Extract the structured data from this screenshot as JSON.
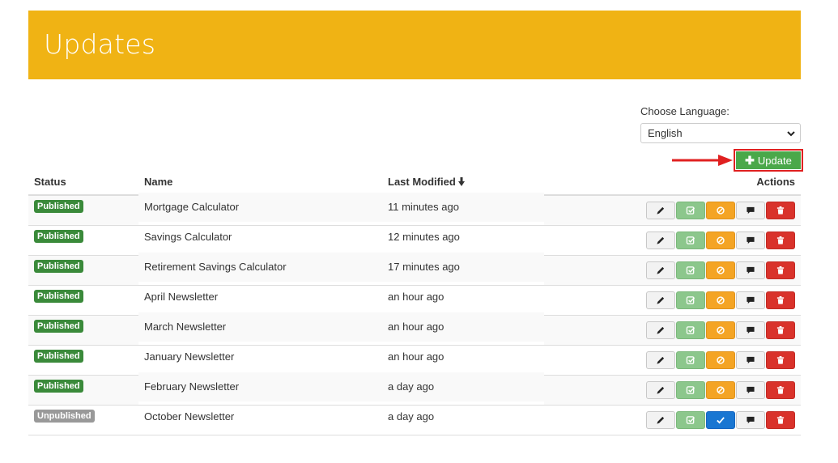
{
  "header": {
    "title": "Updates",
    "color": "#f0b314"
  },
  "language": {
    "label": "Choose Language:",
    "selected": "English"
  },
  "toolbar": {
    "update_label": "Update"
  },
  "table": {
    "columns": {
      "status": "Status",
      "name": "Name",
      "last_modified": "Last Modified",
      "actions": "Actions"
    },
    "rows": [
      {
        "status": "Published",
        "name": "Mortgage Calculator",
        "modified": "11 minutes ago"
      },
      {
        "status": "Published",
        "name": "Savings Calculator",
        "modified": "12 minutes ago"
      },
      {
        "status": "Published",
        "name": "Retirement Savings Calculator",
        "modified": "17 minutes ago"
      },
      {
        "status": "Published",
        "name": "April Newsletter",
        "modified": "an hour ago"
      },
      {
        "status": "Published",
        "name": "March Newsletter",
        "modified": "an hour ago"
      },
      {
        "status": "Published",
        "name": "January Newsletter",
        "modified": "an hour ago"
      },
      {
        "status": "Published",
        "name": "February Newsletter",
        "modified": "a day ago"
      },
      {
        "status": "Unpublished",
        "name": "October Newsletter",
        "modified": "a day ago"
      }
    ]
  },
  "icons": {
    "edit": "pencil-icon",
    "check": "check-square-icon",
    "block": "ban-icon",
    "approve": "checkmark-icon",
    "comment": "comment-icon",
    "delete": "trash-icon",
    "sort": "arrow-down-icon"
  }
}
